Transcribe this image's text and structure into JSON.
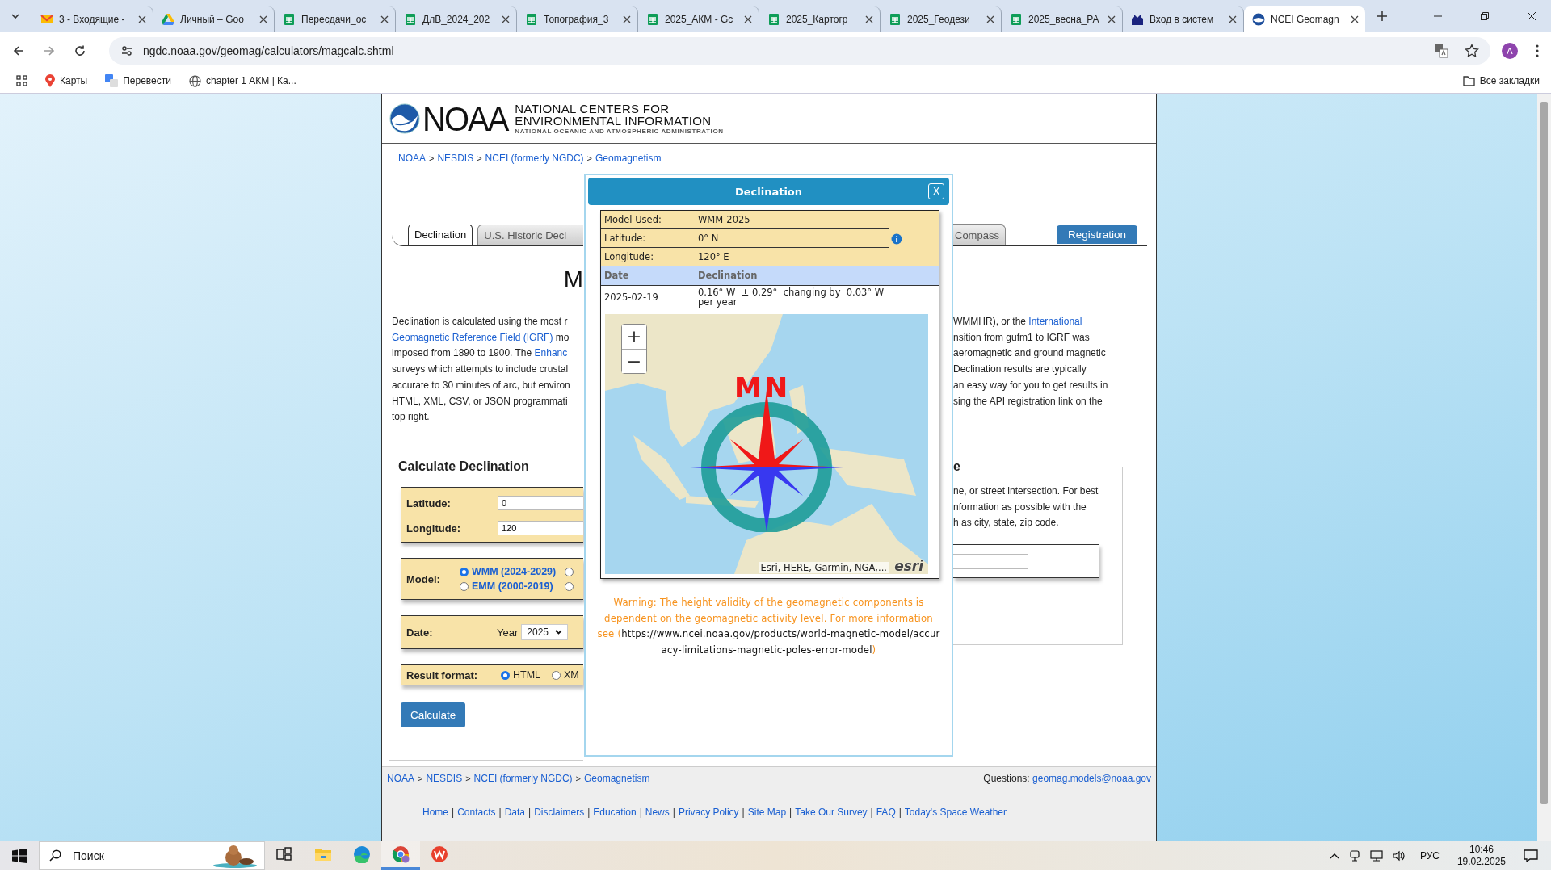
{
  "browser": {
    "tabs": [
      {
        "label": "3 - Входящие -",
        "kind": "mail",
        "selected": false
      },
      {
        "label": "Личный – Goo",
        "kind": "drive",
        "selected": false
      },
      {
        "label": "Пересдачи_ос",
        "kind": "sheet",
        "selected": false
      },
      {
        "label": "ДлВ_2024_202",
        "kind": "sheet",
        "selected": false
      },
      {
        "label": "Топография_3",
        "kind": "sheet",
        "selected": false
      },
      {
        "label": "2025_АКМ - Gc",
        "kind": "sheet",
        "selected": false
      },
      {
        "label": "2025_Картогр",
        "kind": "sheet",
        "selected": false
      },
      {
        "label": "2025_Геодези",
        "kind": "sheet",
        "selected": false
      },
      {
        "label": "2025_весна_РА",
        "kind": "sheet",
        "selected": false
      },
      {
        "label": "Вход в систем",
        "kind": "site",
        "selected": false
      },
      {
        "label": "NCEI Geomagn",
        "kind": "noaa",
        "selected": true
      }
    ],
    "address": "ngdc.noaa.gov/geomag/calculators/magcalc.shtml",
    "profile": "A",
    "bookmarks": [
      {
        "label": "Карты",
        "kind": "maps"
      },
      {
        "label": "Перевести",
        "kind": "translate"
      },
      {
        "label": "chapter 1 АКМ | Ка...",
        "kind": "site"
      }
    ],
    "all_bookmarks": "Все закладки"
  },
  "header": {
    "logo": "NOAA",
    "title_lines": [
      "NATIONAL CENTERS FOR",
      "ENVIRONMENTAL INFORMATION"
    ],
    "subtitle": "NATIONAL OCEANIC AND ATMOSPHERIC ADMINISTRATION"
  },
  "breadcrumb": {
    "items": [
      "NOAA",
      "NESDIS",
      "NCEI (formerly NGDC)",
      "Geomagnetism"
    ],
    "separator": ">"
  },
  "page_tabs": [
    {
      "label": "Declination",
      "selected": true
    },
    {
      "label": "U.S. Historic Decl",
      "selected": false
    },
    {
      "label": "Compass",
      "selected": false
    }
  ],
  "registration": "Registration",
  "heading_fragment": "M",
  "intro_left": [
    [
      {
        "text": "Declination is calculated using the most r",
        "link": false
      }
    ],
    [
      {
        "text": "Geomagnetic Reference Field (IGRF)",
        "link": true
      },
      {
        "text": " mo",
        "link": false
      }
    ],
    [
      {
        "text": "imposed from 1890 to 1900. The ",
        "link": false
      },
      {
        "text": "Enhanc",
        "link": true
      }
    ],
    [
      {
        "text": "surveys which attempts to include crustal",
        "link": false
      }
    ],
    [
      {
        "text": "accurate to 30 minutes of arc, but environ",
        "link": false
      }
    ],
    [
      {
        "text": "HTML, XML, CSV, or JSON programmati",
        "link": false
      }
    ],
    [
      {
        "text": "top right.",
        "link": false
      }
    ]
  ],
  "intro_right": [
    [
      {
        "text": "WMMHR), or the ",
        "link": false
      },
      {
        "text": "International",
        "link": true
      }
    ],
    [
      {
        "text": "nsition from gufm1 to IGRF was",
        "link": false
      }
    ],
    [
      {
        "text": "aeromagnetic and ground magnetic",
        "link": false
      }
    ],
    [
      {
        "text": "Declination results are typically",
        "link": false
      }
    ],
    [
      {
        "text": "an easy way for you to get results in",
        "link": false
      }
    ],
    [
      {
        "text": "sing the API registration link on the",
        "link": false
      }
    ]
  ],
  "calculator": {
    "legend": "Calculate Declination",
    "latitude": {
      "label": "Latitude:",
      "value": "0"
    },
    "longitude": {
      "label": "Longitude:",
      "value": "120"
    },
    "model": {
      "label": "Model:",
      "options": [
        {
          "label": "WMM (2024-2029)",
          "selected": true
        },
        {
          "selected": false
        },
        {
          "label": "EMM (2000-2019)",
          "selected": false
        },
        {
          "selected": false
        }
      ]
    },
    "date": {
      "label": "Date:",
      "year_label": "Year",
      "year": "2025"
    },
    "format": {
      "label": "Result format:",
      "options": [
        {
          "label": "HTML",
          "selected": true
        },
        {
          "label": "XM",
          "selected": false
        }
      ]
    },
    "button": "Calculate"
  },
  "address_search": {
    "legend": "e",
    "lines": [
      "ne, or street intersection. For best",
      "nformation as possible with the",
      "h as city, state, zip code."
    ]
  },
  "modal": {
    "title": "Declination",
    "close": "X",
    "summary": [
      {
        "label": "Model Used:",
        "value": "WMM-2025"
      },
      {
        "label": "Latitude:",
        "value": "0° N"
      },
      {
        "label": "Longitude:",
        "value": "120° E"
      }
    ],
    "columns": [
      "Date",
      "Declination"
    ],
    "rows": [
      {
        "date": "2025-02-19",
        "declination": "0.16° W  ± 0.29°  changing by  0.03° W per year"
      }
    ],
    "map": {
      "zoom_in": "+",
      "zoom_out": "−",
      "compass_label": "MN",
      "attribution": "Esri, HERE, Garmin, NGA,...",
      "logo": "esri"
    },
    "warning": {
      "text": "Warning: The height validity of the geomagnetic components is dependent on the geomagnetic activity level. For more information see (",
      "link": "https://www.ncei.noaa.gov/products/world-magnetic-model/accuracy-limitations-magnetic-poles-error-model",
      "close": ")"
    }
  },
  "footer": {
    "breadcrumb": [
      "NOAA",
      "NESDIS",
      "NCEI (formerly NGDC)",
      "Geomagnetism"
    ],
    "separator": ">",
    "questions_label": "Questions:",
    "email": "geomag.models@noaa.gov",
    "links": [
      "Home",
      "Contacts",
      "Data",
      "Disclaimers",
      "Education",
      "News",
      "Privacy Policy",
      "Site Map",
      "Take Our Survey",
      "FAQ",
      "Today's Space Weather"
    ],
    "link_separator": "|"
  },
  "taskbar": {
    "search": "Поиск",
    "apps": [
      {
        "kind": "taskview",
        "selected": false
      },
      {
        "kind": "explorer",
        "selected": false
      },
      {
        "kind": "edge",
        "selected": false
      },
      {
        "kind": "chrome",
        "selected": true
      },
      {
        "kind": "wps",
        "selected": false
      }
    ],
    "language": "РУС",
    "time": "10:46",
    "date": "19.02.2025"
  }
}
